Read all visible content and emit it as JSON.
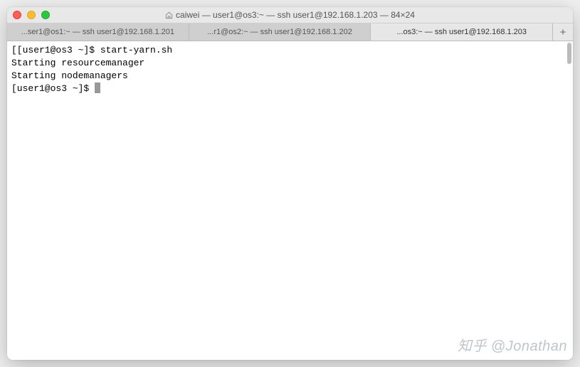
{
  "window": {
    "title": "caiwei — user1@os3:~ — ssh user1@192.168.1.203 — 84×24"
  },
  "tabs": [
    {
      "label": "...ser1@os1:~ — ssh user1@192.168.1.201",
      "active": false
    },
    {
      "label": "...r1@os2:~ — ssh user1@192.168.1.202",
      "active": false
    },
    {
      "label": "...os3:~ — ssh user1@192.168.1.203",
      "active": true
    }
  ],
  "new_tab_label": "+",
  "terminal": {
    "lines": [
      "[[user1@os3 ~]$ start-yarn.sh",
      "Starting resourcemanager",
      "Starting nodemanagers"
    ],
    "prompt": "[user1@os3 ~]$ "
  },
  "watermark": "知乎 @Jonathan"
}
